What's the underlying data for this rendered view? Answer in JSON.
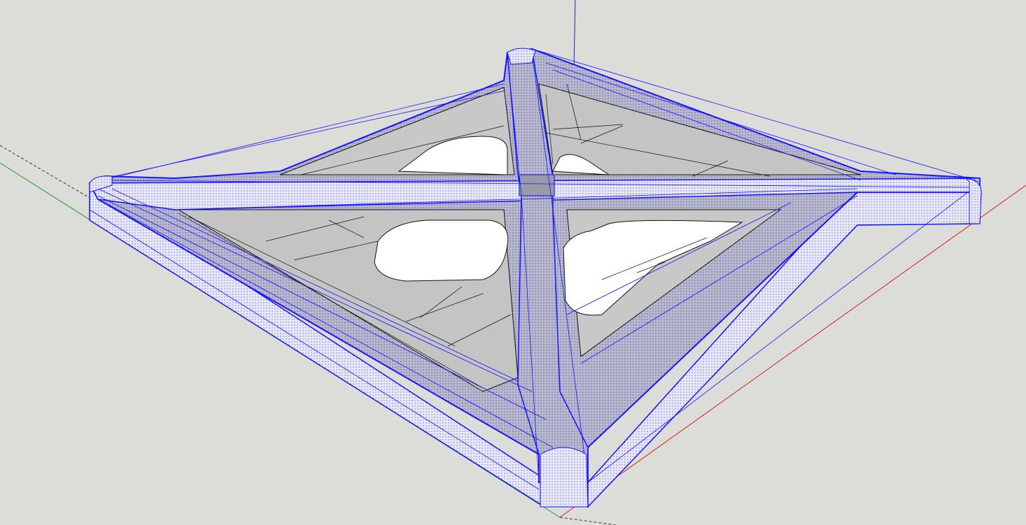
{
  "app": {
    "kind": "3D modeling viewport",
    "background_color": "#dcdcd8"
  },
  "viewport": {
    "axes": {
      "red_axis_color": "#cc2222",
      "green_axis_color": "#2a9a2a",
      "blue_axis_color": "#2222cc",
      "hidden_axis_style": "dashed"
    },
    "model": {
      "description_icon": "cross-frame-model",
      "shape": "X-shaped frame with four fork arms and four rounded slots",
      "selection_state": "selected",
      "selection_color": "#1414ff",
      "face_fill": "#c4c4c4",
      "selected_face_fill": "#ececf8",
      "edge_color": "#111111",
      "slot_count": 4,
      "arm_count": 4
    }
  }
}
